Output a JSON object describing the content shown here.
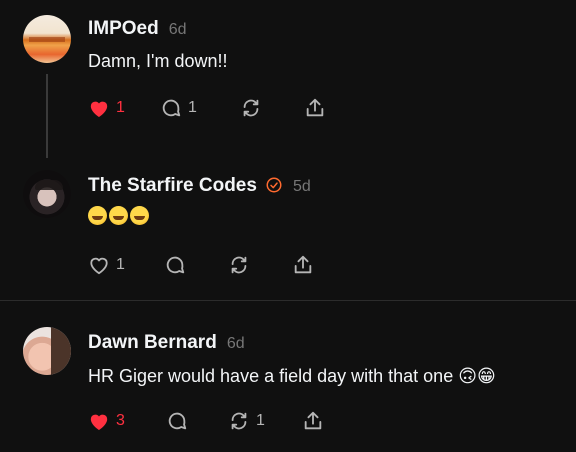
{
  "posts": [
    {
      "username": "IMPOed",
      "time": "6d",
      "text": "Damn, I'm down!!",
      "likes": "1",
      "replies": "1",
      "reposts": "",
      "liked": true
    },
    {
      "username": "The Starfire Codes",
      "time": "5d",
      "text": "🤣🤣🤣",
      "likes": "1",
      "replies": "",
      "reposts": "",
      "liked": false,
      "verified": true
    },
    {
      "username": "Dawn Bernard",
      "time": "6d",
      "text": "HR Giger would have a field day with that one 🙃😁",
      "likes": "3",
      "replies": "",
      "reposts": "1",
      "liked": true
    }
  ],
  "colors": {
    "background": "#101010",
    "liked": "#ff3040",
    "icon": "#b5b5b5",
    "verified": "#ff6a2f"
  },
  "icons": [
    "heart-icon",
    "comment-icon",
    "repost-icon",
    "share-icon",
    "verified-icon"
  ]
}
